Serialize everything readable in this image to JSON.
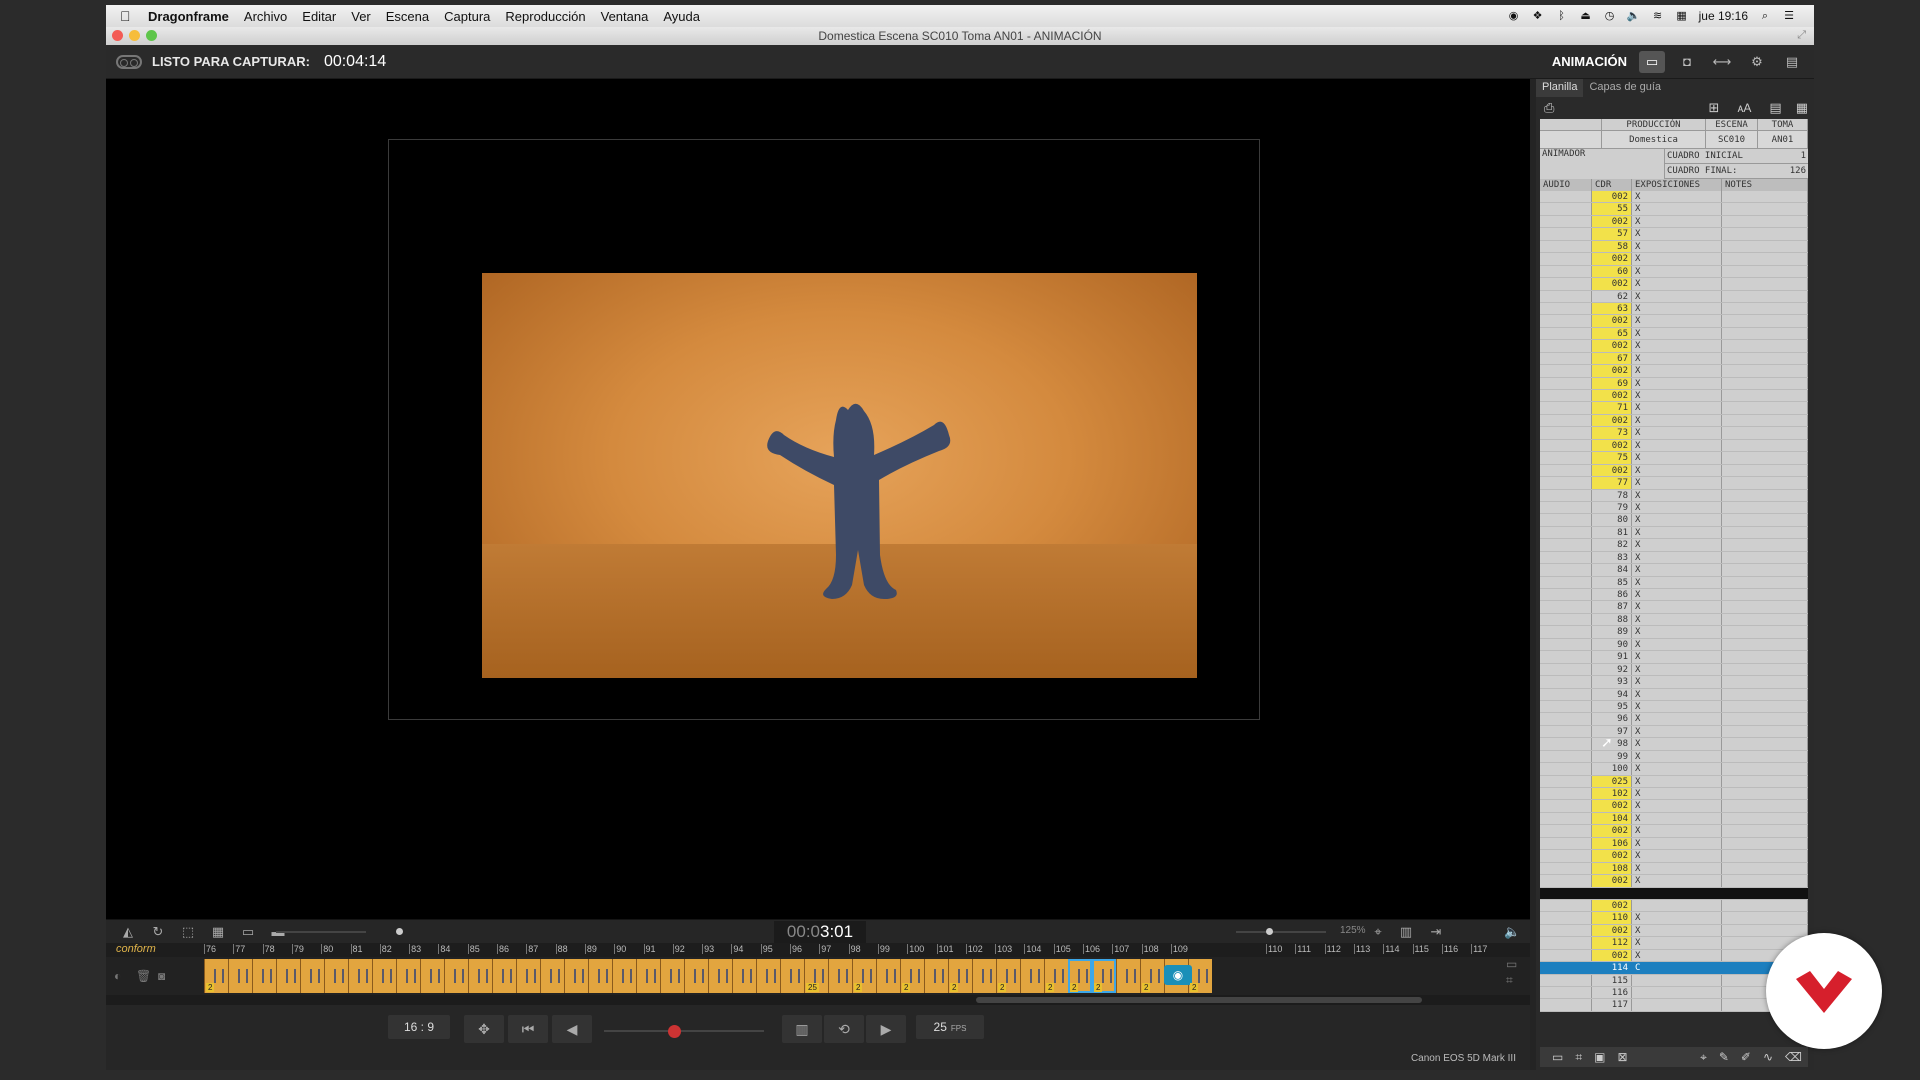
{
  "menubar": {
    "app_name": "Dragonframe",
    "items": [
      "Archivo",
      "Editar",
      "Ver",
      "Escena",
      "Captura",
      "Reproducción",
      "Ventana",
      "Ayuda"
    ],
    "clock": "jue 19:16"
  },
  "window": {
    "title": "Domestica  Escena SC010  Toma AN01 - ANIMACIÓN"
  },
  "toolbar": {
    "status_label": "LISTO PARA CAPTURAR:",
    "status_time": "00:04:14",
    "mode_label": "ANIMACIÓN"
  },
  "timeline": {
    "timecode_dim": "00:0",
    "timecode_bright": "3:01",
    "zoom": "125%",
    "track_name": "conform",
    "ruler": [
      "76",
      "77",
      "78",
      "79",
      "80",
      "81",
      "82",
      "83",
      "84",
      "85",
      "86",
      "87",
      "88",
      "89",
      "90",
      "91",
      "92",
      "93",
      "94",
      "95",
      "96",
      "97",
      "98",
      "99",
      "100",
      "101",
      "102",
      "103",
      "104",
      "105",
      "106",
      "107",
      "108",
      "109",
      "110",
      "111",
      "112",
      "113",
      "114",
      "115",
      "116",
      "117"
    ],
    "frames": [
      {
        "hold": "2"
      },
      {},
      {},
      {},
      {},
      {},
      {},
      {},
      {},
      {},
      {},
      {},
      {},
      {},
      {},
      {},
      {},
      {},
      {},
      {},
      {},
      {},
      {},
      {},
      {},
      {
        "hold": "25"
      },
      {},
      {
        "hold": "2"
      },
      {},
      {
        "hold": "2"
      },
      {},
      {
        "hold": "2"
      },
      {},
      {
        "hold": "2"
      },
      {},
      {
        "hold": "2"
      },
      {
        "hold": "2",
        "selected": true
      },
      {
        "hold": "2",
        "selected": true
      },
      {},
      {
        "hold": "2"
      },
      {},
      {
        "hold": "2"
      }
    ]
  },
  "transport": {
    "aspect": "16 : 9",
    "fps_value": "25",
    "fps_unit": "FPS",
    "camera": "Canon EOS 5D Mark III"
  },
  "panel": {
    "tabs": [
      "Planilla",
      "Capas de guía"
    ],
    "headers": {
      "production": "PRODUCCIÓN",
      "scene": "ESCENA",
      "take": "TOMA"
    },
    "values": {
      "production": "Domestica",
      "scene": "SC010",
      "take": "AN01"
    },
    "animator_label": "ANIMADOR",
    "start_label": "CUADRO INICIAL",
    "start_value": "1",
    "end_label": "CUADRO FINAL:",
    "end_value": "126",
    "columns": [
      "AUDIO",
      "CDR",
      "EXPOSICIONES",
      "NOTES"
    ],
    "rows": [
      {
        "n": "002",
        "hl": true,
        "x": "X"
      },
      {
        "n": "55",
        "hl": true,
        "x": "X"
      },
      {
        "n": "002",
        "hl": true,
        "x": "X"
      },
      {
        "n": "57",
        "hl": true,
        "x": "X"
      },
      {
        "n": "58",
        "hl": true,
        "x": "X"
      },
      {
        "n": "002",
        "hl": true,
        "x": "X"
      },
      {
        "n": "60",
        "hl": true,
        "x": "X"
      },
      {
        "n": "002",
        "hl": true,
        "x": "X"
      },
      {
        "n": "62",
        "x": "X"
      },
      {
        "n": "63",
        "hl": true,
        "x": "X"
      },
      {
        "n": "002",
        "hl": true,
        "x": "X"
      },
      {
        "n": "65",
        "hl": true,
        "x": "X"
      },
      {
        "n": "002",
        "hl": true,
        "x": "X"
      },
      {
        "n": "67",
        "hl": true,
        "x": "X"
      },
      {
        "n": "002",
        "hl": true,
        "x": "X"
      },
      {
        "n": "69",
        "hl": true,
        "x": "X"
      },
      {
        "n": "002",
        "hl": true,
        "x": "X"
      },
      {
        "n": "71",
        "hl": true,
        "x": "X"
      },
      {
        "n": "002",
        "hl": true,
        "x": "X"
      },
      {
        "n": "73",
        "hl": true,
        "x": "X"
      },
      {
        "n": "002",
        "hl": true,
        "x": "X"
      },
      {
        "n": "75",
        "hl": true,
        "x": "X"
      },
      {
        "n": "002",
        "hl": true,
        "x": "X"
      },
      {
        "n": "77",
        "hl": true,
        "x": "X"
      },
      {
        "n": "78",
        "x": "X"
      },
      {
        "n": "79",
        "x": "X"
      },
      {
        "n": "80",
        "x": "X"
      },
      {
        "n": "81",
        "x": "X"
      },
      {
        "n": "82",
        "x": "X"
      },
      {
        "n": "83",
        "x": "X"
      },
      {
        "n": "84",
        "x": "X"
      },
      {
        "n": "85",
        "x": "X"
      },
      {
        "n": "86",
        "x": "X"
      },
      {
        "n": "87",
        "x": "X"
      },
      {
        "n": "88",
        "x": "X"
      },
      {
        "n": "89",
        "x": "X"
      },
      {
        "n": "90",
        "x": "X"
      },
      {
        "n": "91",
        "x": "X"
      },
      {
        "n": "92",
        "x": "X"
      },
      {
        "n": "93",
        "x": "X"
      },
      {
        "n": "94",
        "x": "X"
      },
      {
        "n": "95",
        "x": "X"
      },
      {
        "n": "96",
        "x": "X"
      },
      {
        "n": "97",
        "x": "X"
      },
      {
        "n": "98",
        "x": "X"
      },
      {
        "n": "99",
        "x": "X"
      },
      {
        "n": "100",
        "x": "X"
      },
      {
        "n": "025",
        "hl": true,
        "x": "X"
      },
      {
        "n": "102",
        "hl": true,
        "x": "X"
      },
      {
        "n": "002",
        "hl": true,
        "x": "X"
      },
      {
        "n": "104",
        "hl": true,
        "x": "X"
      },
      {
        "n": "002",
        "hl": true,
        "x": "X"
      },
      {
        "n": "106",
        "hl": true,
        "x": "X"
      },
      {
        "n": "002",
        "hl": true,
        "x": "X"
      },
      {
        "n": "108",
        "hl": true,
        "x": "X"
      },
      {
        "n": "002",
        "hl": true,
        "x": "X"
      },
      {
        "n": "",
        "dark": true,
        "x": ""
      },
      {
        "n": "002",
        "hl": true,
        "x": ""
      },
      {
        "n": "110",
        "hl": true,
        "x": "X"
      },
      {
        "n": "002",
        "hl": true,
        "x": "X"
      },
      {
        "n": "112",
        "hl": true,
        "x": "X"
      },
      {
        "n": "002",
        "hl": true,
        "x": "X"
      },
      {
        "n": "114",
        "current": true,
        "x": "C"
      },
      {
        "n": "115",
        "x": ""
      },
      {
        "n": "116",
        "x": ""
      },
      {
        "n": "117",
        "x": ""
      }
    ]
  }
}
